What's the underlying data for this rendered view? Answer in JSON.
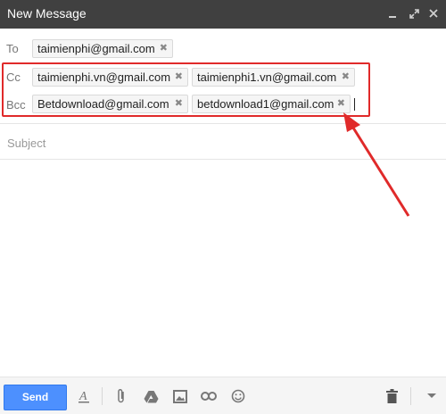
{
  "window": {
    "title": "New Message"
  },
  "recipients": {
    "to": {
      "label": "To",
      "chips": [
        "taimienphi@gmail.com"
      ]
    },
    "cc": {
      "label": "Cc",
      "chips": [
        "taimienphi.vn@gmail.com",
        "taimienphi1.vn@gmail.com"
      ]
    },
    "bcc": {
      "label": "Bcc",
      "chips": [
        "Betdownload@gmail.com",
        "betdownload1@gmail.com"
      ]
    }
  },
  "subject": {
    "placeholder": "Subject",
    "value": ""
  },
  "toolbar": {
    "send_label": "Send",
    "icons": [
      "format-text-icon",
      "attach-icon",
      "drive-icon",
      "insert-photo-icon",
      "link-icon",
      "emoji-icon",
      "trash-icon",
      "more-options-icon"
    ]
  },
  "colors": {
    "titlebar": "#404040",
    "send_button": "#4d90fe",
    "annotation": "#e02a2a",
    "chip_background": "#f5f5f5"
  }
}
